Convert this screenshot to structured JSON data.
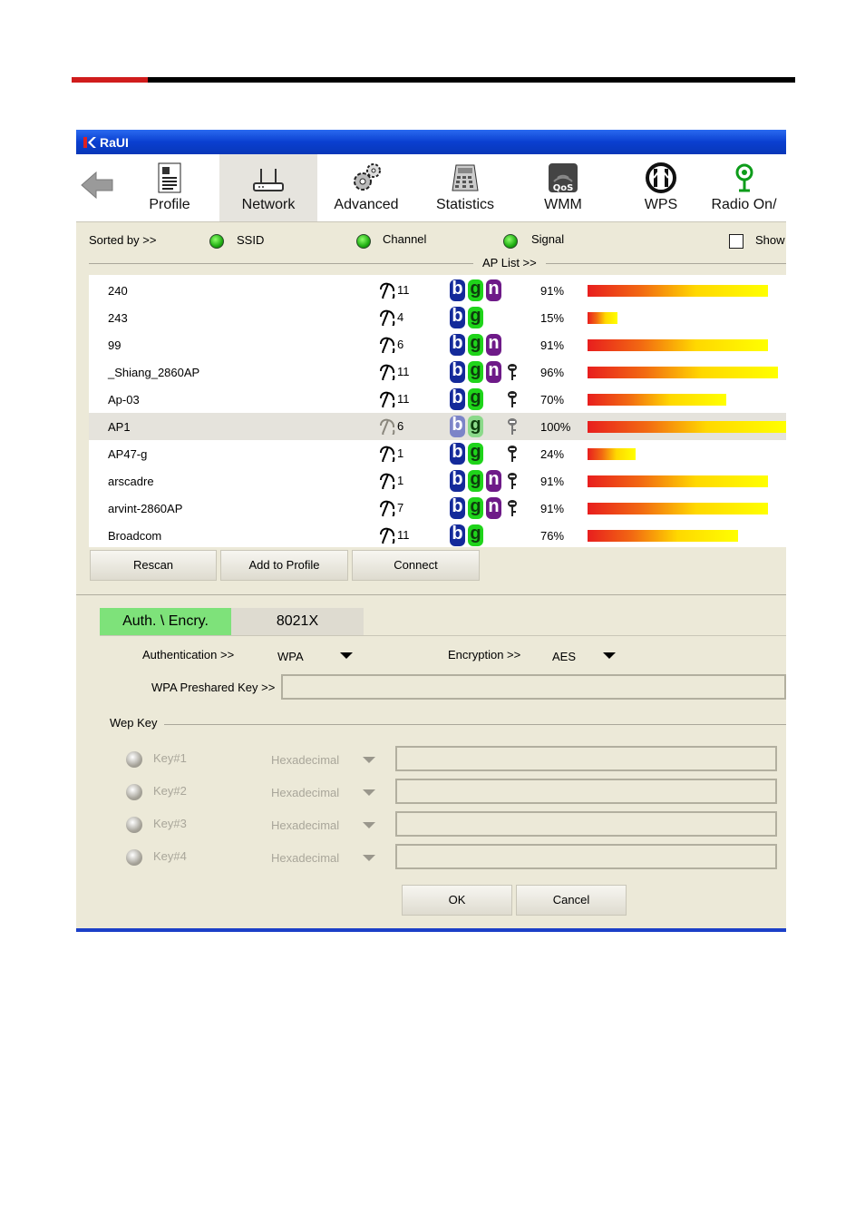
{
  "window": {
    "title": "RaUI"
  },
  "toolbar": {
    "items": [
      {
        "label": "Profile",
        "icon": "profile-icon"
      },
      {
        "label": "Network",
        "icon": "network-icon"
      },
      {
        "label": "Advanced",
        "icon": "advanced-icon"
      },
      {
        "label": "Statistics",
        "icon": "statistics-icon"
      },
      {
        "label": "WMM",
        "icon": "qos-icon"
      },
      {
        "label": "WPS",
        "icon": "wps-icon"
      },
      {
        "label": "Radio On/",
        "icon": "radio-icon"
      }
    ]
  },
  "sort": {
    "label": "Sorted by >>",
    "ssid": "SSID",
    "channel": "Channel",
    "signal": "Signal",
    "show": "Show"
  },
  "ap_list": {
    "label": "AP List >>",
    "rows": [
      {
        "ssid": "240",
        "channel": "11",
        "b": "b",
        "g": "g",
        "n": "n",
        "signal": "91%",
        "signal_value": 91
      },
      {
        "ssid": "243",
        "channel": "4",
        "b": "b",
        "g": "g",
        "n": "",
        "signal": "15%",
        "signal_value": 15
      },
      {
        "ssid": "99",
        "channel": "6",
        "b": "b",
        "g": "g",
        "n": "n",
        "signal": "91%",
        "signal_value": 91
      },
      {
        "ssid": "_Shiang_2860AP",
        "channel": "11",
        "b": "b",
        "g": "g",
        "n": "n",
        "signal": "96%",
        "signal_value": 96
      },
      {
        "ssid": "Ap-03",
        "channel": "11",
        "b": "b",
        "g": "g",
        "n": "",
        "signal": "70%",
        "signal_value": 70
      },
      {
        "ssid": "AP1",
        "channel": "6",
        "b": "b",
        "g": "g",
        "n": "",
        "signal": "100%",
        "signal_value": 100
      },
      {
        "ssid": "AP47-g",
        "channel": "1",
        "b": "b",
        "g": "g",
        "n": "",
        "signal": "24%",
        "signal_value": 24
      },
      {
        "ssid": "arscadre",
        "channel": "1",
        "b": "b",
        "g": "g",
        "n": "n",
        "signal": "91%",
        "signal_value": 91
      },
      {
        "ssid": "arvint-2860AP",
        "channel": "7",
        "b": "b",
        "g": "g",
        "n": "n",
        "signal": "91%",
        "signal_value": 91
      },
      {
        "ssid": "Broadcom",
        "channel": "11",
        "b": "b",
        "g": "g",
        "n": "",
        "signal": "76%",
        "signal_value": 76
      }
    ]
  },
  "buttons": {
    "rescan": "Rescan",
    "add_to_profile": "Add to Profile",
    "connect": "Connect",
    "ok": "OK",
    "cancel": "Cancel"
  },
  "tabs": {
    "auth": "Auth. \\ Encry.",
    "x8021": "8021X"
  },
  "security": {
    "auth_label": "Authentication >>",
    "auth_value": "WPA",
    "enc_label": "Encryption >>",
    "enc_value": "AES",
    "psk_label": "WPA Preshared Key >>",
    "psk_value": "",
    "wep_label": "Wep Key",
    "keys": [
      {
        "label": "Key#1",
        "format": "Hexadecimal"
      },
      {
        "label": "Key#2",
        "format": "Hexadecimal"
      },
      {
        "label": "Key#3",
        "format": "Hexadecimal"
      },
      {
        "label": "Key#4",
        "format": "Hexadecimal"
      }
    ]
  }
}
